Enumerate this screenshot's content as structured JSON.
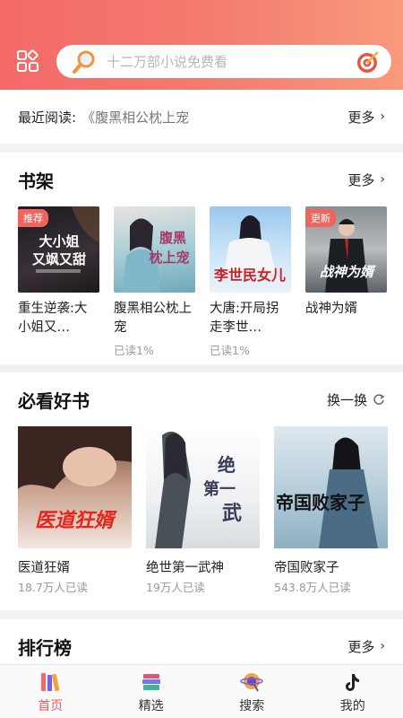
{
  "search": {
    "placeholder": "十二万部小说免费看"
  },
  "recent": {
    "label": "最近阅读:",
    "book": "《腹黑相公枕上宠",
    "more": "更多"
  },
  "bookshelf": {
    "title": "书架",
    "more": "更多",
    "items": [
      {
        "title": "重生逆袭:大小姐又…",
        "progress": "",
        "badge": "推荐",
        "cover_text": "大小姐又飒又甜"
      },
      {
        "title": "腹黑相公枕上宠",
        "progress": "已读1%",
        "badge": "",
        "cover_text": "腹黑相公枕上宠"
      },
      {
        "title": "大唐:开局拐走李世…",
        "progress": "已读1%",
        "badge": "",
        "cover_text": "李世民女儿"
      },
      {
        "title": "战神为婿",
        "progress": "",
        "badge": "更新",
        "cover_text": "战神为婿"
      }
    ]
  },
  "must_read": {
    "title": "必看好书",
    "refresh": "换一换",
    "items": [
      {
        "title": "医道狂婿",
        "readers": "18.7万人已读",
        "cover_text": "医道狂婿"
      },
      {
        "title": "绝世第一武神",
        "readers": "19万人已读",
        "cover_text": "绝世第一武神"
      },
      {
        "title": "帝国败家子",
        "readers": "543.8万人已读",
        "cover_text": "帝国败家子"
      }
    ]
  },
  "ranking": {
    "title": "排行榜",
    "more": "更多"
  },
  "nav": [
    {
      "label": "首页",
      "icon": "books-icon",
      "active": true
    },
    {
      "label": "精选",
      "icon": "stack-books-icon",
      "active": false
    },
    {
      "label": "搜索",
      "icon": "planet-search-icon",
      "active": false
    },
    {
      "label": "我的",
      "icon": "tiktok-note-icon",
      "active": false
    }
  ],
  "colors": {
    "accent": "#ef5b5b",
    "header_start": "#f46a6a",
    "header_end": "#f79a7a"
  }
}
